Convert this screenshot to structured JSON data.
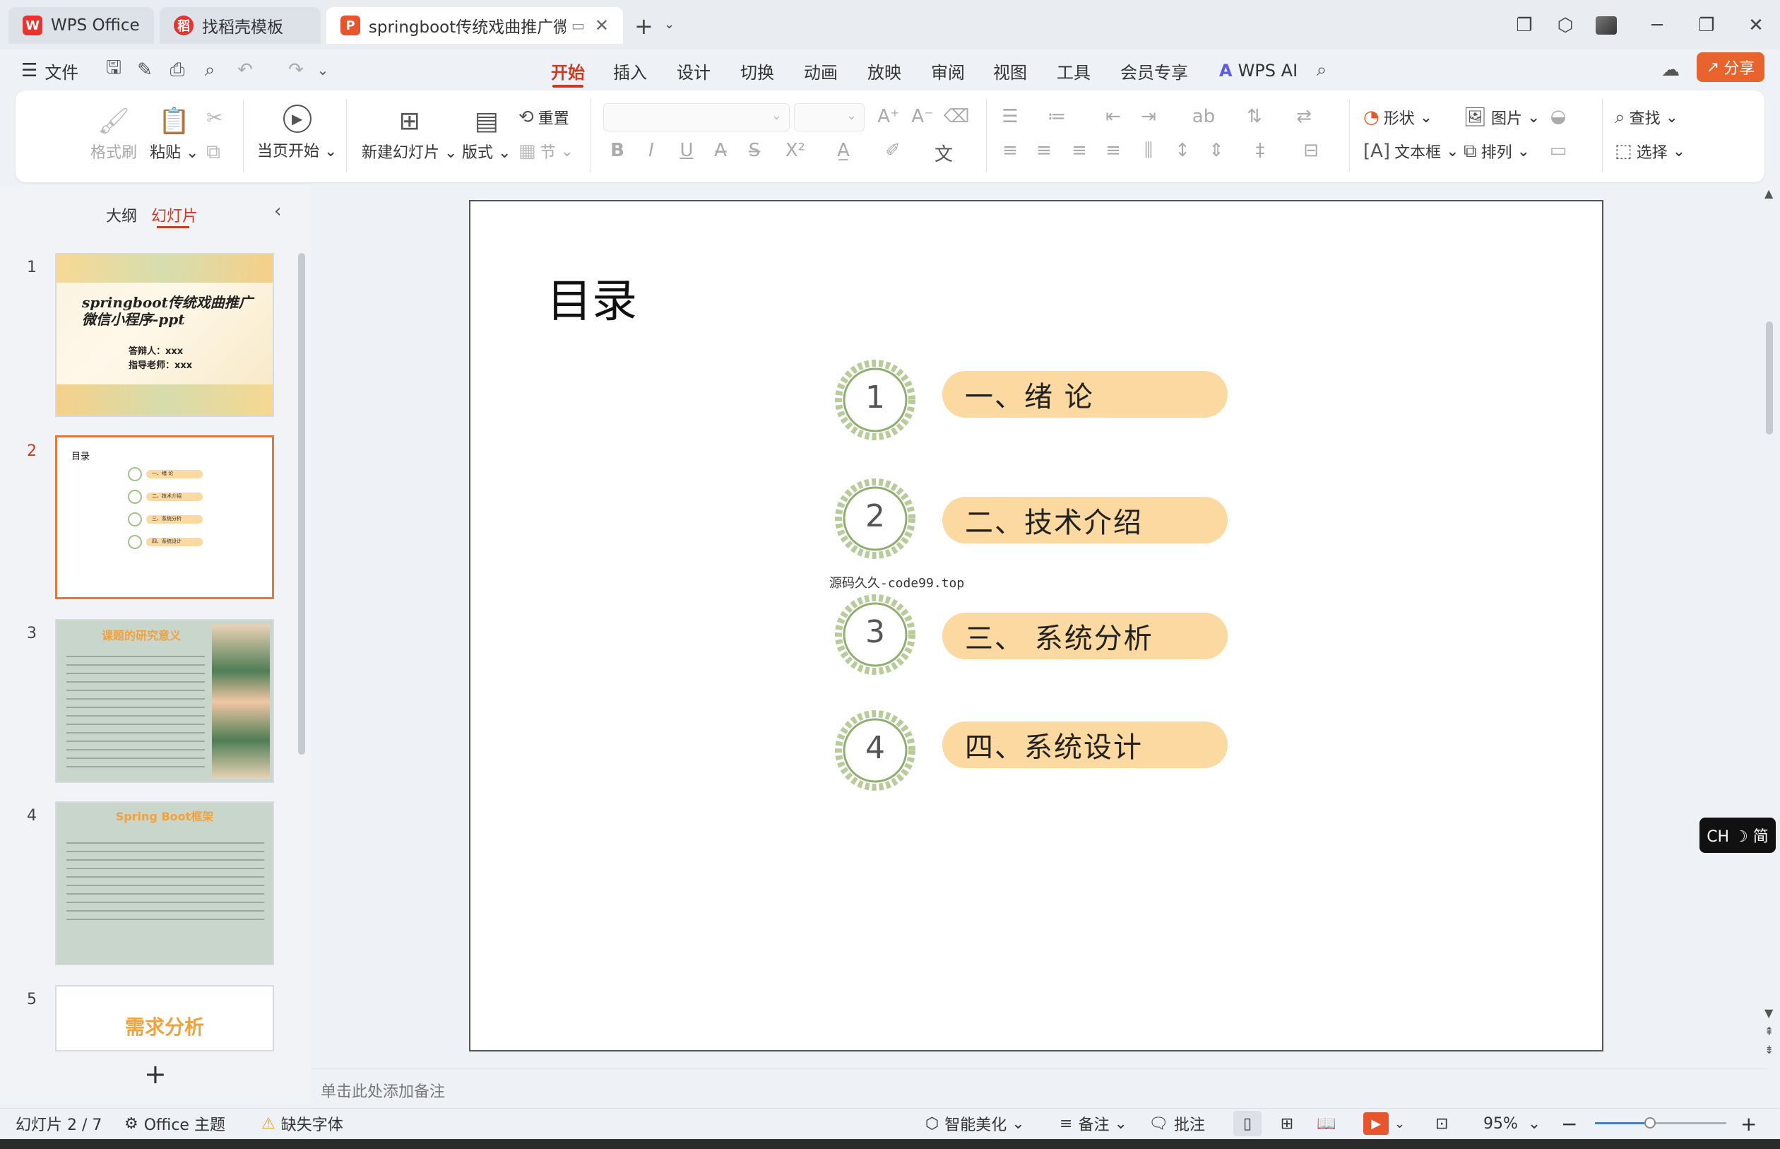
{
  "tabs": [
    {
      "label": "WPS Office",
      "icon": "wps-logo-icon"
    },
    {
      "label": "找稻壳模板",
      "icon": "docer-icon"
    },
    {
      "label": "springboot传统戏曲推广微信",
      "icon": "presentation-icon"
    }
  ],
  "menu": {
    "file": "文件",
    "items": [
      "开始",
      "插入",
      "设计",
      "切换",
      "动画",
      "放映",
      "审阅",
      "视图",
      "工具",
      "会员专享"
    ],
    "active": "开始",
    "wps_ai": "WPS AI",
    "share": "分享"
  },
  "ribbon": {
    "format_painter": "格式刷",
    "paste": "粘贴",
    "play_current": "当页开始",
    "new_slide": "新建幻灯片",
    "layout": "版式",
    "reset": "重置",
    "section": "节",
    "shape": "形状",
    "picture": "图片",
    "textbox": "文本框",
    "arrange": "排列",
    "find": "查找",
    "select": "选择"
  },
  "left_panel": {
    "outline_tab": "大纲",
    "slides_tab": "幻灯片",
    "thumbnails": [
      {
        "num": "1",
        "title": "springboot传统戏曲推广微信小程序-ppt",
        "line1": "答辩人：xxx",
        "line2": "指导老师：xxx"
      },
      {
        "num": "2",
        "title": "目录",
        "items": [
          "一、绪 论",
          "二、技术介绍",
          "三、系统分析",
          "四、系统设计"
        ]
      },
      {
        "num": "3",
        "title": "课题的研究意义"
      },
      {
        "num": "4",
        "title": "Spring Boot框架"
      },
      {
        "num": "5",
        "title": "需求分析"
      }
    ],
    "add_slide": "+"
  },
  "slide": {
    "title": "目录",
    "items": [
      {
        "num": "1",
        "label": "一、绪  论"
      },
      {
        "num": "2",
        "label": "二、技术介绍"
      },
      {
        "num": "3",
        "label": "三、  系统分析"
      },
      {
        "num": "4",
        "label": "四、系统设计"
      }
    ],
    "watermark": "源码久久-code99.top"
  },
  "notes_placeholder": "单击此处添加备注",
  "status": {
    "slide_count": "幻灯片 2 / 7",
    "theme": "Office 主题",
    "missing_font": "缺失字体",
    "beautify": "智能美化",
    "notes": "备注",
    "comments": "批注",
    "zoom": "95%",
    "zoom_fraction": 0.42
  },
  "ime": "CH ☽ 简",
  "colors": {
    "accent": "#c83c22",
    "pill": "#fbd9a0",
    "share_btn": "#e8642c"
  }
}
